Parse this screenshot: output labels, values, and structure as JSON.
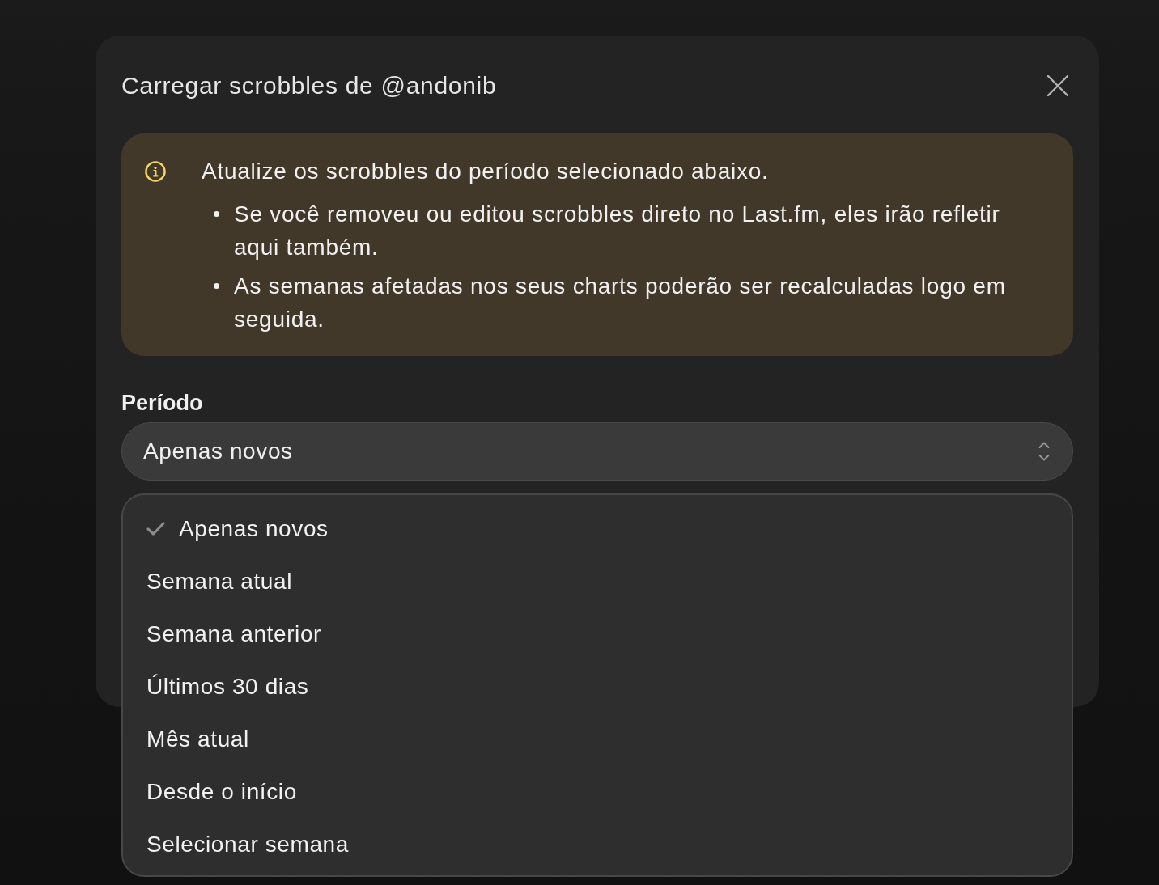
{
  "dialog": {
    "title": "Carregar scrobbles de @andonib"
  },
  "notice": {
    "heading": "Atualize os scrobbles do período selecionado abaixo.",
    "points": [
      "Se você removeu ou editou scrobbles direto no Last.fm, eles irão refletir aqui também.",
      "As semanas afetadas nos seus charts poderão ser recalculadas logo em seguida."
    ]
  },
  "period_field": {
    "label": "Período",
    "value": "Apenas novos",
    "expanded": true
  },
  "period_options": [
    {
      "label": "Apenas novos",
      "selected": true
    },
    {
      "label": "Semana atual",
      "selected": false
    },
    {
      "label": "Semana anterior",
      "selected": false
    },
    {
      "label": "Últimos 30 dias",
      "selected": false
    },
    {
      "label": "Mês atual",
      "selected": false
    },
    {
      "label": "Desde o início",
      "selected": false
    },
    {
      "label": "Selecionar semana",
      "selected": false
    }
  ]
}
